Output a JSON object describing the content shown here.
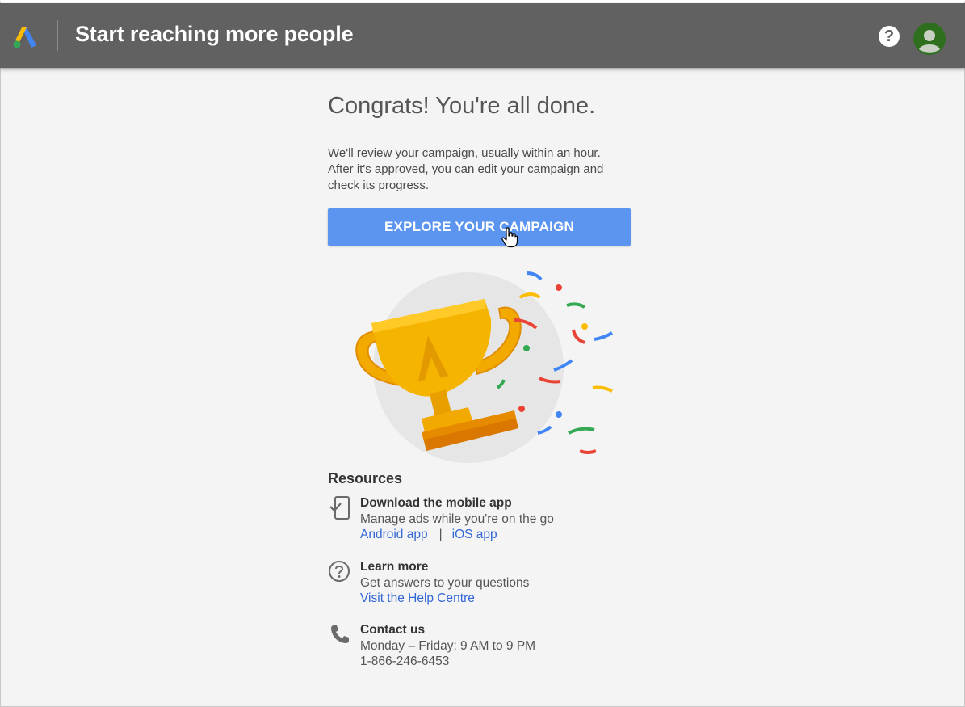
{
  "header": {
    "title": "Start reaching more people",
    "help_symbol": "?"
  },
  "main": {
    "heading": "Congrats! You're all done.",
    "description_lines": [
      "We'll review your campaign, usually within an hour.",
      "After it's approved, you can edit your campaign and",
      "check its progress."
    ],
    "explore_button": "EXPLORE YOUR CAMPAIGN"
  },
  "resources": {
    "title": "Resources",
    "items": [
      {
        "icon": "mobile-check-icon",
        "heading": "Download the mobile app",
        "text": "Manage ads while you're on the go",
        "link_android": "Android app",
        "separator": "|",
        "link_ios": "iOS app"
      },
      {
        "icon": "help-circle-icon",
        "heading": "Learn more",
        "text": "Get answers to your questions",
        "link": "Visit the Help Centre"
      },
      {
        "icon": "phone-icon",
        "heading": "Contact us",
        "text": "Monday – Friday: 9 AM to 9 PM",
        "phone": "1-866-246-6453"
      }
    ]
  },
  "colors": {
    "header_bg": "#616161",
    "page_bg": "#f4f4f4",
    "button_bg": "#5b95f0",
    "link": "#3367d6",
    "trophy_gold": "#f2a900"
  }
}
